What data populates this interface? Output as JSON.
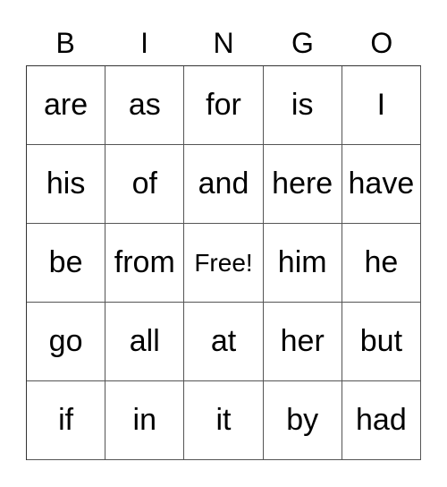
{
  "header": [
    "B",
    "I",
    "N",
    "G",
    "O"
  ],
  "rows": [
    [
      "are",
      "as",
      "for",
      "is",
      "I"
    ],
    [
      "his",
      "of",
      "and",
      "here",
      "have"
    ],
    [
      "be",
      "from",
      "Free!",
      "him",
      "he"
    ],
    [
      "go",
      "all",
      "at",
      "her",
      "but"
    ],
    [
      "if",
      "in",
      "it",
      "by",
      "had"
    ]
  ],
  "free_cell": {
    "row": 2,
    "col": 2
  }
}
